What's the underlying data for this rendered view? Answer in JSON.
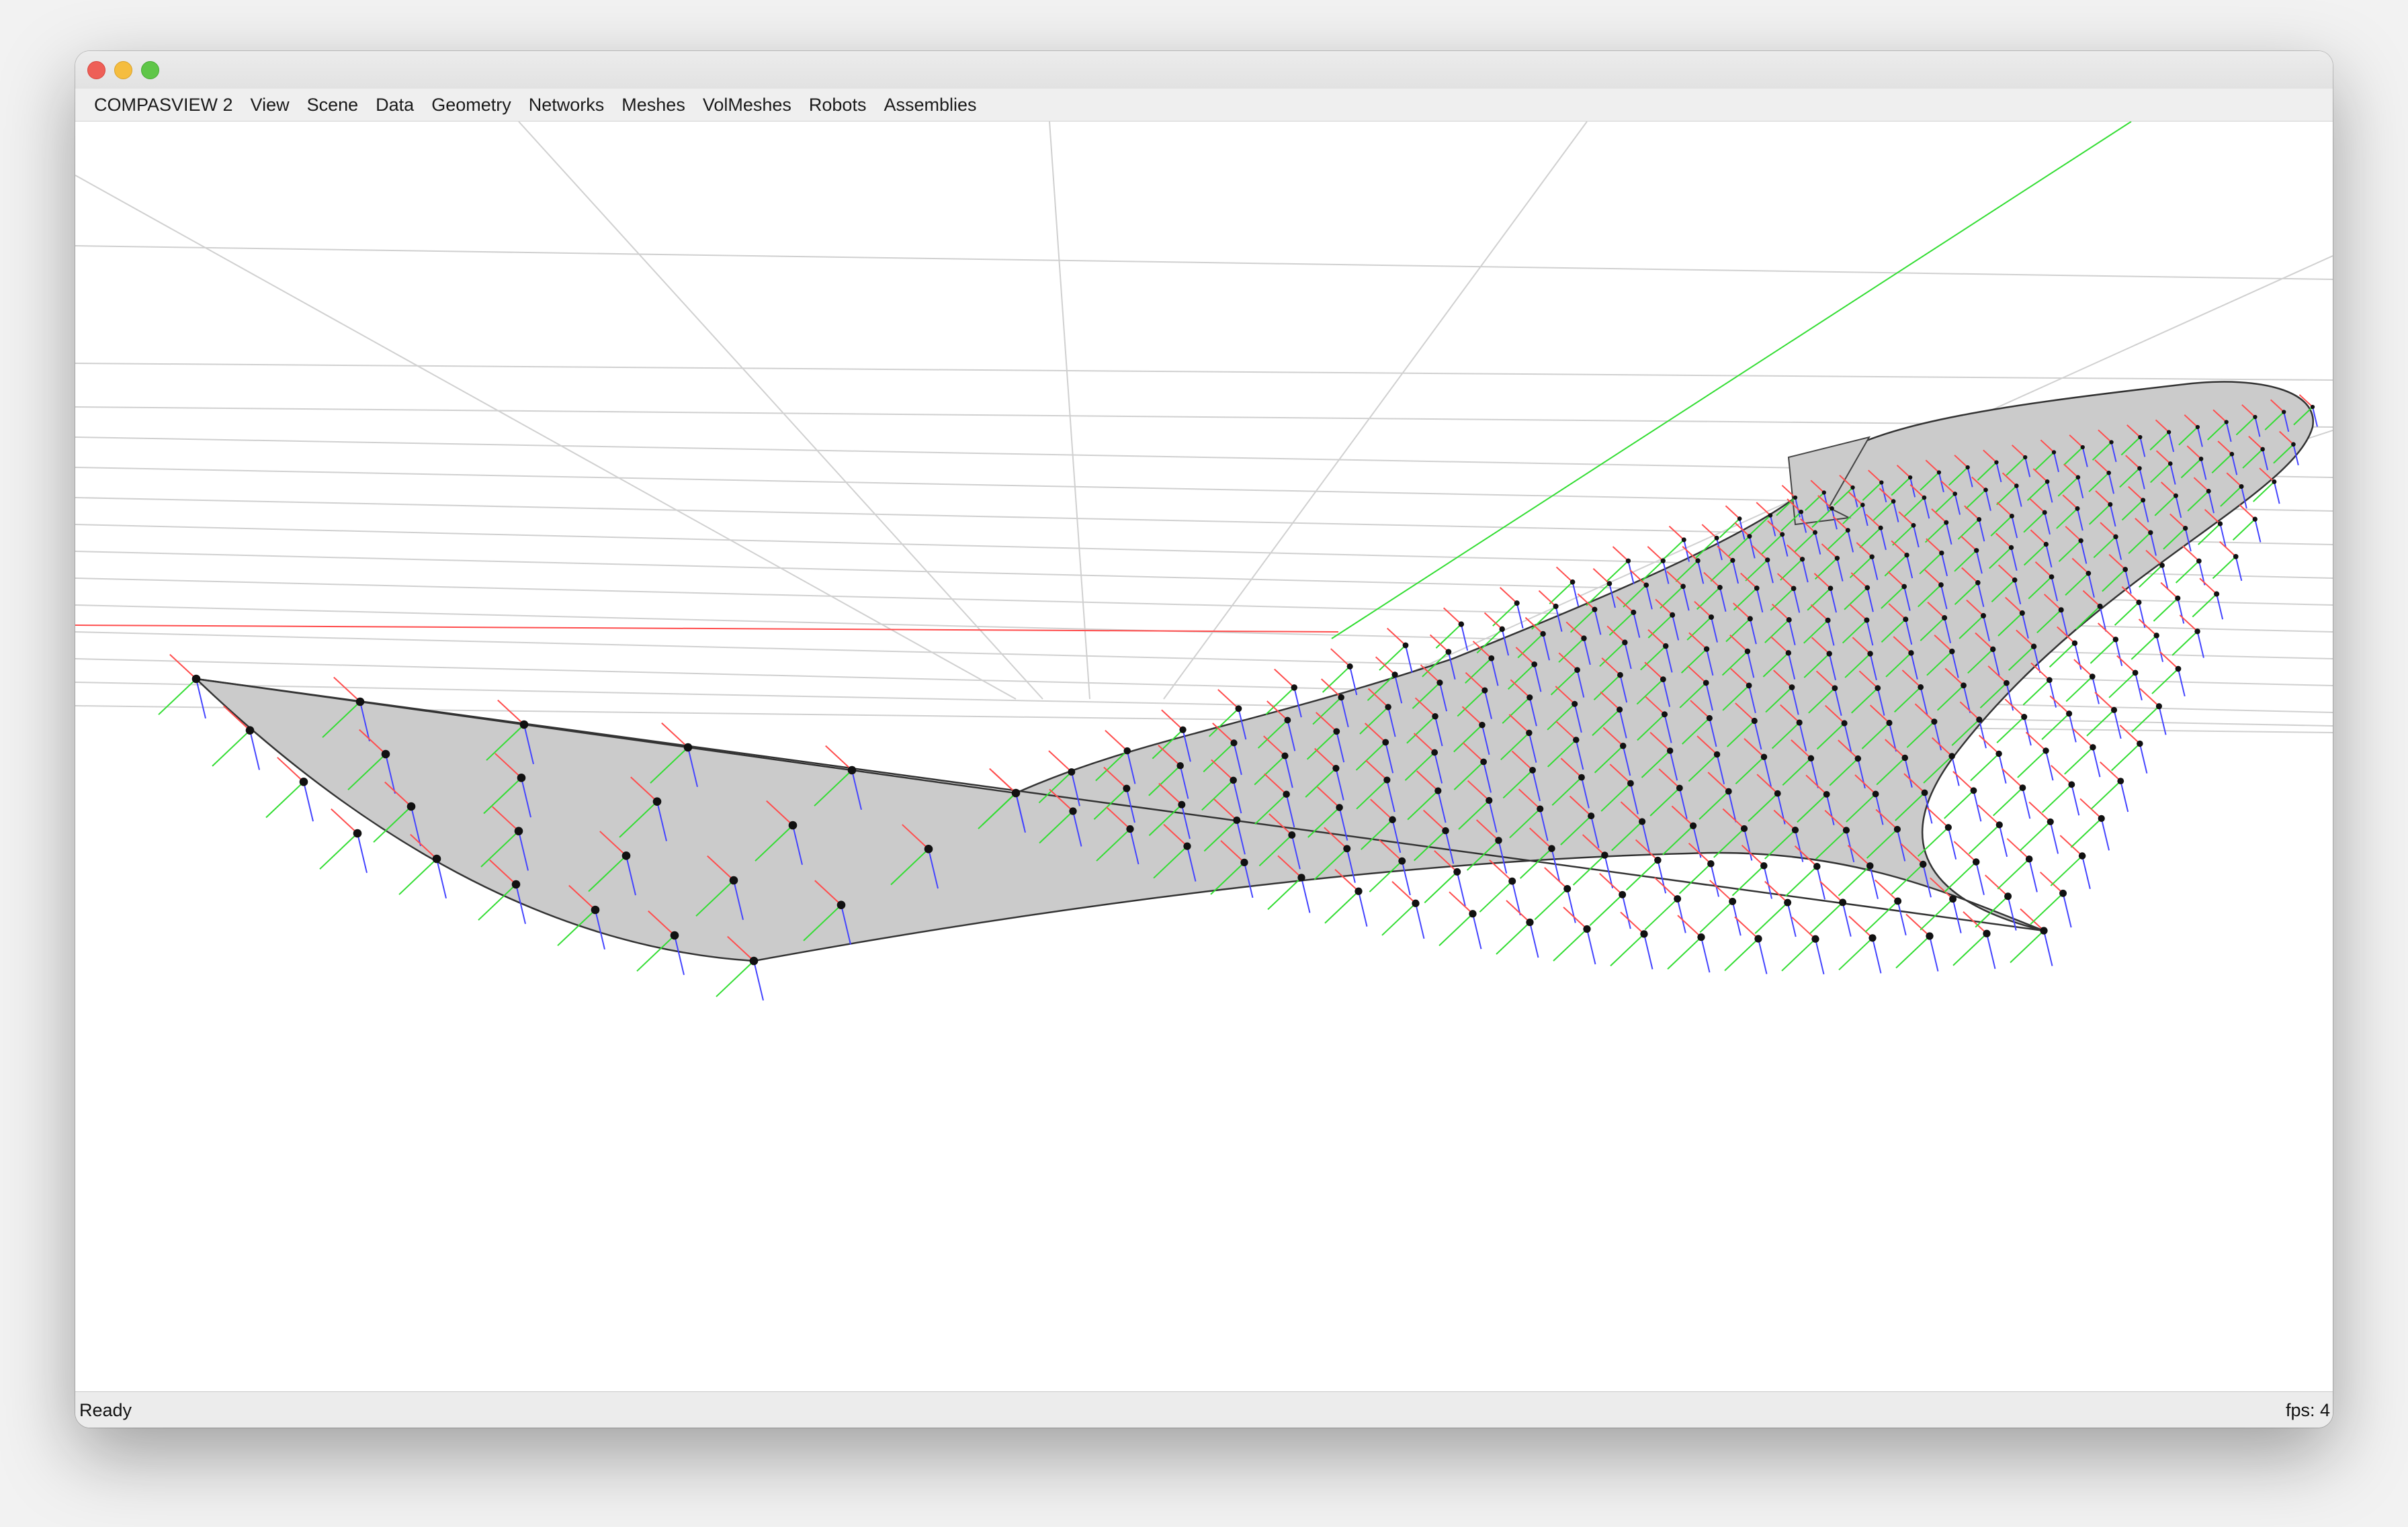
{
  "window": {
    "buttons": {
      "close": "close-button",
      "minimize": "minimize-button",
      "maximize": "maximize-button"
    }
  },
  "menu": {
    "items": [
      {
        "label": "COMPASVIEW 2"
      },
      {
        "label": "View"
      },
      {
        "label": "Scene"
      },
      {
        "label": "Data"
      },
      {
        "label": "Geometry"
      },
      {
        "label": "Networks"
      },
      {
        "label": "Meshes"
      },
      {
        "label": "VolMeshes"
      },
      {
        "label": "Robots"
      },
      {
        "label": "Assemblies"
      }
    ]
  },
  "viewport": {
    "background": "#ffffff",
    "surface_fill": "#cbcbcb",
    "grid_color": "#d0d0d0",
    "axis_colors": {
      "x": "#ff4d4d",
      "y": "#33dd33",
      "z": "#4444ff"
    }
  },
  "status": {
    "left": "Ready",
    "right": "fps: 4"
  }
}
